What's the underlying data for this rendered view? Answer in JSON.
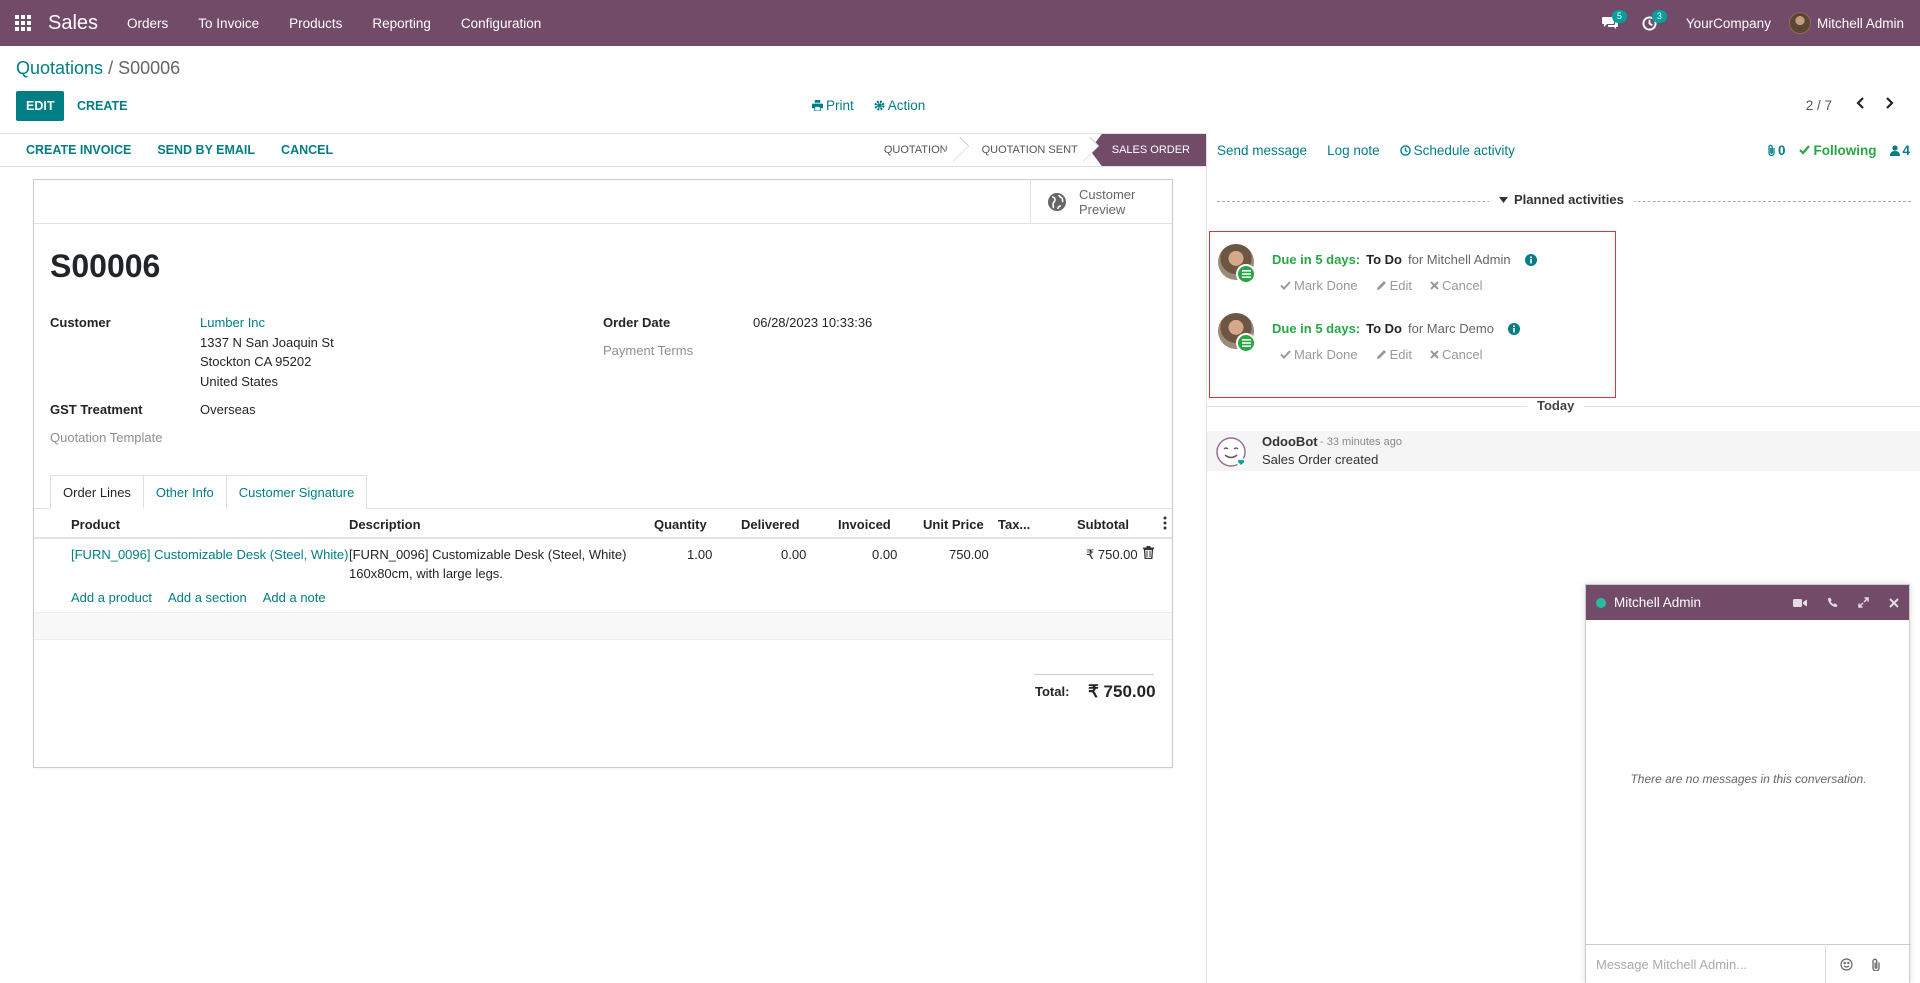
{
  "navbar": {
    "app_name": "Sales",
    "menu": [
      "Orders",
      "To Invoice",
      "Products",
      "Reporting",
      "Configuration"
    ],
    "messages_badge": "5",
    "activities_badge": "3",
    "company": "YourCompany",
    "user": "Mitchell Admin",
    "bg_color": "#714B67"
  },
  "breadcrumb": {
    "parent": "Quotations",
    "separator": "/",
    "current": "S00006"
  },
  "control_panel": {
    "edit": "EDIT",
    "create": "CREATE",
    "print": "Print",
    "action": "Action",
    "pager": "2 / 7"
  },
  "statusbar": {
    "buttons": [
      "CREATE INVOICE",
      "SEND BY EMAIL",
      "CANCEL"
    ],
    "stages": [
      "QUOTATION",
      "QUOTATION SENT",
      "SALES ORDER"
    ],
    "active_stage": "SALES ORDER"
  },
  "form": {
    "customer_preview": [
      "Customer",
      "Preview"
    ],
    "title": "S00006",
    "customer_label": "Customer",
    "customer_name": "Lumber Inc",
    "address": [
      "1337 N San Joaquin St",
      "Stockton CA 95202",
      "United States"
    ],
    "gst_label": "GST Treatment",
    "gst_value": "Overseas",
    "template_label": "Quotation Template",
    "order_date_label": "Order Date",
    "order_date_value": "06/28/2023 10:33:36",
    "payment_terms_label": "Payment Terms",
    "tabs": [
      "Order Lines",
      "Other Info",
      "Customer Signature"
    ],
    "active_tab": "Order Lines"
  },
  "order_lines": {
    "columns": [
      "Product",
      "Description",
      "Quantity",
      "Delivered",
      "Invoiced",
      "Unit Price",
      "Tax...",
      "Subtotal"
    ],
    "rows": [
      {
        "product": "[FURN_0096] Customizable Desk (Steel, White)",
        "description_1": "[FURN_0096] Customizable Desk (Steel, White)",
        "description_2": "160x80cm, with large legs.",
        "quantity": "1.00",
        "delivered": "0.00",
        "invoiced": "0.00",
        "unit_price": "750.00",
        "taxes": "",
        "subtotal": "₹ 750.00"
      }
    ],
    "add_product": "Add a product",
    "add_section": "Add a section",
    "add_note": "Add a note",
    "total_label": "Total:",
    "total_value": "₹ 750.00"
  },
  "chatter": {
    "send_message": "Send message",
    "log_note": "Log note",
    "schedule_activity": "Schedule activity",
    "attachments_count": "0",
    "following": "Following",
    "followers_count": "4",
    "planned_activities": "Planned activities",
    "activities": [
      {
        "due": "Due in 5 days:",
        "type": "To Do",
        "for": "for Mitchell Admin"
      },
      {
        "due": "Due in 5 days:",
        "type": "To Do",
        "for": "for Marc Demo"
      }
    ],
    "activity_actions": {
      "mark_done": "Mark Done",
      "edit": "Edit",
      "cancel": "Cancel"
    },
    "today": "Today",
    "messages": [
      {
        "author": "OdooBot",
        "date": "- 33 minutes ago",
        "body": "Sales Order created"
      }
    ]
  },
  "chat_window": {
    "title": "Mitchell Admin",
    "empty_text": "There are no messages in this conversation.",
    "placeholder": "Message Mitchell Admin..."
  },
  "colors": {
    "primary": "#714B67",
    "link": "#017e84",
    "success": "#28a745",
    "highlight_border": "#e0333a"
  }
}
